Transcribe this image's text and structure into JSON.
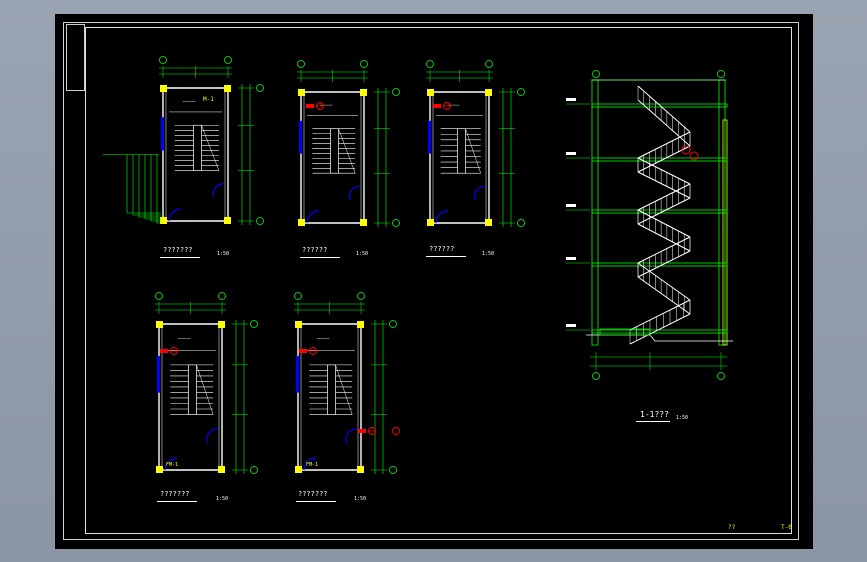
{
  "drawing": {
    "plan_titles": [
      "???????",
      "??????",
      "??????",
      "???????",
      "???????"
    ],
    "plan_scale": "1:50",
    "section_title": "1-1???",
    "section_scale": "1:50",
    "corner_left": "??",
    "corner_right": "T-0",
    "door_tag_1": "M-1",
    "door_tag_2": "FM-1",
    "door_tag_3": "FM-1"
  },
  "colors": {
    "background": "#000000",
    "walls": "#ffffff",
    "columns": "#ffff00",
    "dimensions": "#00ff00",
    "windows": "#0000ff",
    "doors": "#0000ff",
    "hydrant": "#ff0000"
  },
  "icons": [
    "grid-axis-bubble-icon",
    "fire-hydrant-icon",
    "stair-arrow-icon"
  ]
}
